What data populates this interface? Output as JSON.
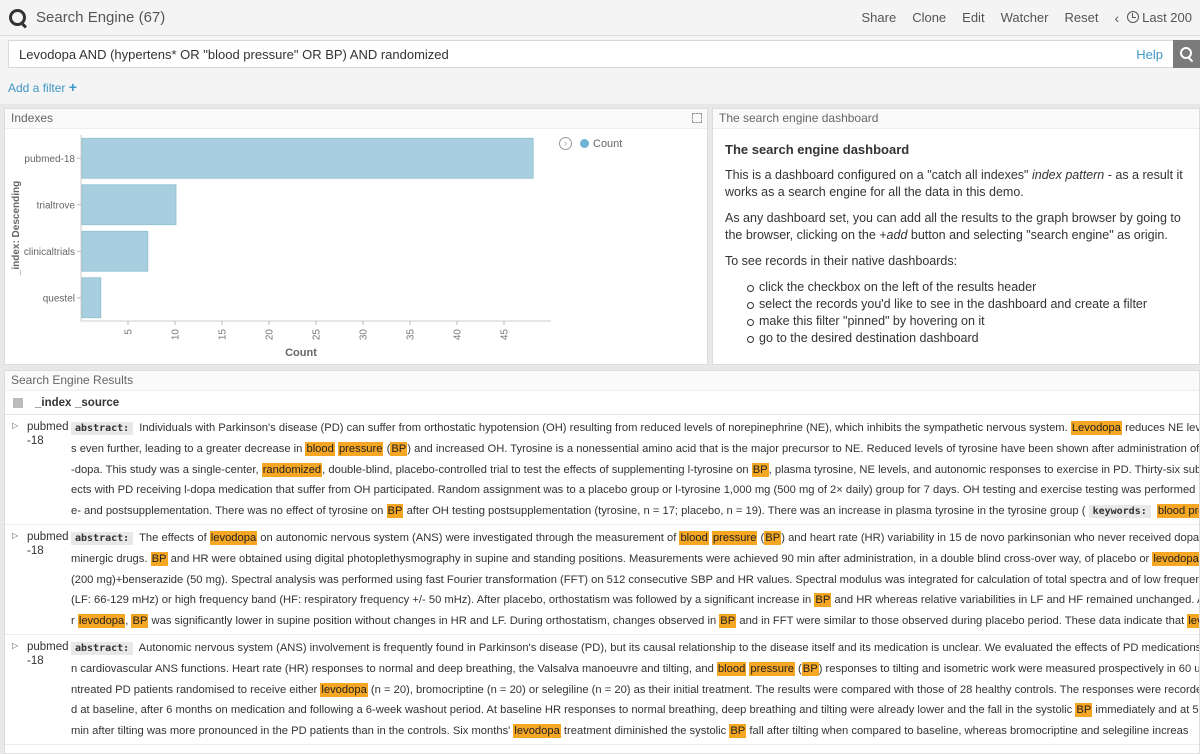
{
  "app": {
    "title": "Search Engine (67)"
  },
  "menu": {
    "share": "Share",
    "clone": "Clone",
    "edit": "Edit",
    "watcher": "Watcher",
    "reset": "Reset",
    "time": "Last 200"
  },
  "query": {
    "value": "Levodopa AND (hypertens* OR \"blood pressure\" OR BP) AND randomized",
    "help": "Help"
  },
  "filter": {
    "add": "Add a filter"
  },
  "panels": {
    "indexes": "Indexes",
    "dashboard": "The search engine dashboard",
    "results": "Search Engine Results"
  },
  "chart_data": {
    "type": "bar",
    "orientation": "horizontal",
    "categories": [
      "pubmed-18",
      "trialtrove",
      "clinicaltrials",
      "questel"
    ],
    "values": [
      48,
      10,
      7,
      2
    ],
    "xlabel": "Count",
    "ylabel": "_index: Descending",
    "xticks": [
      5,
      10,
      15,
      20,
      25,
      30,
      35,
      40,
      45
    ],
    "xlim": [
      0,
      50
    ],
    "legend": [
      "Count"
    ],
    "legend_position": "top-right",
    "bar_color": "#a8cfdf"
  },
  "dashboard": {
    "heading": "The search engine dashboard",
    "p1_a": "This is a dashboard configured on a \"catch all indexes\" ",
    "p1_em": "index pattern",
    "p1_b": " - as a result it works as a search engine for all the data in this demo.",
    "p2_a": "As any dashboard set, you can add all the results to the graph browser by going to the browser, clicking on the ",
    "p2_em": "+add",
    "p2_b": " button and selecting \"search engine\" as origin.",
    "p3": "To see records in their native dashboards:",
    "steps": [
      "click the checkbox on the left of the results header",
      "select the records you'd like to see in the dashboard and create a filter",
      "make this filter \"pinned\" by hovering on it",
      "go to the desired destination dashboard"
    ]
  },
  "results": {
    "col_index": "_index",
    "col_source": "_source",
    "rows": [
      {
        "index": "pubmed-18",
        "lines": [
          [
            [
              "tag",
              "abstract:"
            ],
            [
              "t",
              " Individuals with Parkinson's disease (PD) can suffer from orthostatic hypotension (OH) resulting from reduced levels of norepinephrine (NE), which inhibits the sympathetic nervous system. "
            ],
            [
              "h",
              "Levodopa"
            ],
            [
              "t",
              " reduces NE level"
            ]
          ],
          [
            [
              "t",
              "s even further, leading to a greater decrease in "
            ],
            [
              "h",
              "blood"
            ],
            [
              "t",
              " "
            ],
            [
              "h",
              "pressure"
            ],
            [
              "t",
              " ("
            ],
            [
              "h",
              "BP"
            ],
            [
              "t",
              ") and increased OH. Tyrosine is a nonessential amino acid that is the major precursor to NE. Reduced levels of tyrosine have been shown after administration of l"
            ]
          ],
          [
            [
              "t",
              "-dopa. This study was a single-center, "
            ],
            [
              "h",
              "randomized"
            ],
            [
              "t",
              ", double-blind, placebo-controlled trial to test the effects of supplementing l-tyrosine on "
            ],
            [
              "h",
              "BP"
            ],
            [
              "t",
              ", plasma tyrosine, NE levels, and autonomic responses to exercise in PD. Thirty-six subj"
            ]
          ],
          [
            [
              "t",
              "ects with PD receiving l-dopa medication that suffer from OH participated. Random assignment was to a placebo group or l-tyrosine 1,000 mg (500 mg of 2× daily) group for 7 days. OH testing and exercise testing was performed pr"
            ]
          ],
          [
            [
              "t",
              "e- and postsupplementation. There was no effect of tyrosine on "
            ],
            [
              "h",
              "BP"
            ],
            [
              "t",
              " after OH testing postsupplementation (tyrosine, n = 17; placebo, n = 19). There was an increase in plasma tyrosine in the tyrosine group ( "
            ],
            [
              "tag",
              "keywords:"
            ],
            [
              "t",
              " "
            ],
            [
              "h",
              "blood pres"
            ]
          ]
        ]
      },
      {
        "index": "pubmed-18",
        "lines": [
          [
            [
              "tag",
              "abstract:"
            ],
            [
              "t",
              " The effects of "
            ],
            [
              "h",
              "levodopa"
            ],
            [
              "t",
              " on autonomic nervous system (ANS) were investigated through the measurement of "
            ],
            [
              "h",
              "blood"
            ],
            [
              "t",
              " "
            ],
            [
              "h",
              "pressure"
            ],
            [
              "t",
              " ("
            ],
            [
              "h",
              "BP"
            ],
            [
              "t",
              ") and heart rate (HR) variability in 15 de novo parkinsonian who never received dopa"
            ]
          ],
          [
            [
              "t",
              "minergic drugs. "
            ],
            [
              "h",
              "BP"
            ],
            [
              "t",
              " and HR were obtained using digital photoplethysmography in supine and standing positions. Measurements were achieved 90 min after administration, in a double blind cross-over way, of placebo or "
            ],
            [
              "h",
              "levodopa"
            ]
          ],
          [
            [
              "t",
              "(200 mg)+benserazide (50 mg). Spectral analysis was performed using fast Fourier transformation (FFT) on 512 consecutive SBP and HR values. Spectral modulus was integrated for calculation of total spectra and of low frequency"
            ]
          ],
          [
            [
              "t",
              "(LF: 66-129 mHz) or high frequency band (HF: respiratory frequency +/- 50 mHz). After placebo, orthostatism was followed by a significant increase in "
            ],
            [
              "h",
              "BP"
            ],
            [
              "t",
              " and HR whereas relative variabilities in LF and HF remained unchanged. Afte"
            ]
          ],
          [
            [
              "t",
              "r "
            ],
            [
              "h",
              "levodopa"
            ],
            [
              "t",
              ", "
            ],
            [
              "h",
              "BP"
            ],
            [
              "t",
              " was significantly lower in supine position without changes in HR and LF. During orthostatism, changes observed in "
            ],
            [
              "h",
              "BP"
            ],
            [
              "t",
              " and in FFT were similar to those observed during placebo period. These data indicate that "
            ],
            [
              "h",
              "lev"
            ]
          ]
        ]
      },
      {
        "index": "pubmed-18",
        "lines": [
          [
            [
              "tag",
              "abstract:"
            ],
            [
              "t",
              " Autonomic nervous system (ANS) involvement is frequently found in Parkinson's disease (PD), but its causal relationship to the disease itself and its medication is unclear. We evaluated the effects of PD medications o"
            ]
          ],
          [
            [
              "t",
              "n cardiovascular ANS functions. Heart rate (HR) responses to normal and deep breathing, the Valsalva manoeuvre and tilting, and "
            ],
            [
              "h",
              "blood"
            ],
            [
              "t",
              " "
            ],
            [
              "h",
              "pressure"
            ],
            [
              "t",
              " ("
            ],
            [
              "h",
              "BP"
            ],
            [
              "t",
              ") responses to tilting and isometric work were measured prospectively in 60 u"
            ]
          ],
          [
            [
              "t",
              "ntreated PD patients randomised to receive either "
            ],
            [
              "h",
              "levodopa"
            ],
            [
              "t",
              " (n = 20), bromocriptine (n = 20) or selegiline (n = 20) as their initial treatment. The results were compared with those of 28 healthy controls. The responses were recorde"
            ]
          ],
          [
            [
              "t",
              "d at baseline, after 6 months on medication and following a 6-week washout period. At baseline HR responses to normal breathing, deep breathing and tilting were already lower and the fall in the systolic "
            ],
            [
              "h",
              "BP"
            ],
            [
              "t",
              " immediately and at 5"
            ]
          ],
          [
            [
              "t",
              "min after tilting was more pronounced in the PD patients than in the controls. Six months' "
            ],
            [
              "h",
              "levodopa"
            ],
            [
              "t",
              " treatment diminished the systolic "
            ],
            [
              "h",
              "BP"
            ],
            [
              "t",
              " fall after tilting when compared to baseline, whereas bromocriptine and selegiline increas"
            ]
          ]
        ]
      }
    ]
  }
}
